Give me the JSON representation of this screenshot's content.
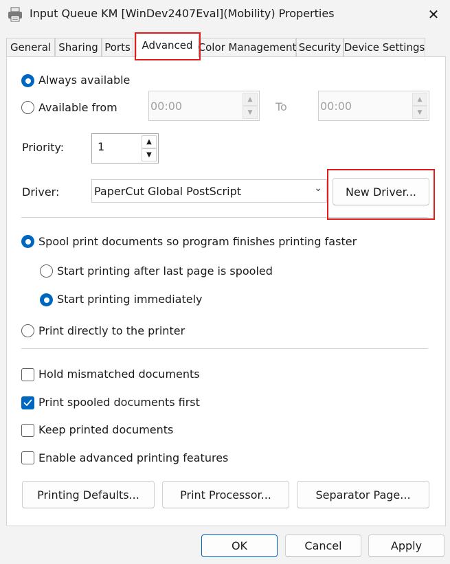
{
  "window": {
    "title": "Input Queue KM [WinDev2407Eval](Mobility) Properties",
    "close_symbol": "✕"
  },
  "tabs": [
    "General",
    "Sharing",
    "Ports",
    "Advanced",
    "Color Management",
    "Security",
    "Device Settings"
  ],
  "active_tab": "Advanced",
  "availability": {
    "always_label": "Always available",
    "from_label": "Available from",
    "from_time": "00:00",
    "to_label": "To",
    "to_time": "00:00",
    "selected": "always"
  },
  "priority": {
    "label": "Priority:",
    "value": "1"
  },
  "driver": {
    "label": "Driver:",
    "value": "PaperCut Global PostScript",
    "new_driver_label": "New Driver..."
  },
  "spooling": {
    "spool_label": "Spool print documents so program finishes printing faster",
    "after_last_label": "Start printing after last page is spooled",
    "immediately_label": "Start printing immediately",
    "direct_label": "Print directly to the printer"
  },
  "options": {
    "hold_mismatched": {
      "label": "Hold mismatched documents",
      "checked": false
    },
    "spooled_first": {
      "label": "Print spooled documents first",
      "checked": true
    },
    "keep_printed": {
      "label": "Keep printed documents",
      "checked": false
    },
    "advanced_features": {
      "label": "Enable advanced printing features",
      "checked": false
    }
  },
  "buttons": {
    "printing_defaults": "Printing Defaults...",
    "print_processor": "Print Processor...",
    "separator_page": "Separator Page...",
    "ok": "OK",
    "cancel": "Cancel",
    "apply": "Apply"
  },
  "colors": {
    "accent": "#0067c0",
    "highlight": "#e21b1b"
  }
}
